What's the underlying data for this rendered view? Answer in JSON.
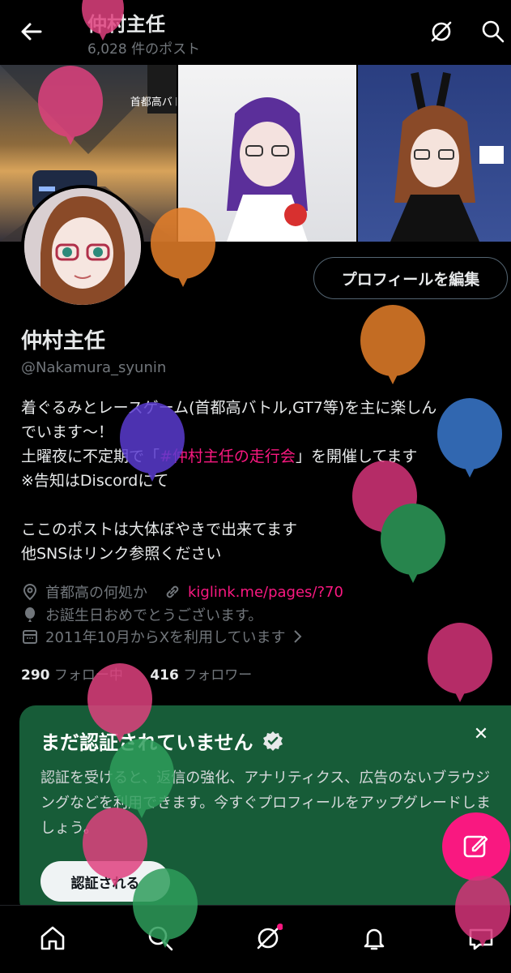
{
  "header": {
    "title": "仲村主任",
    "post_count": "6,028 件のポスト"
  },
  "banner_text": "首都高バトル",
  "profile": {
    "edit_button": "プロフィールを編集",
    "name": "仲村主任",
    "handle": "@Nakamura_syunin",
    "bio_line1": "着ぐるみとレースゲーム(首都高バトル,GT7等)を主に楽しん",
    "bio_line2": "でいます～！",
    "bio_line3_pre": "土曜夜に不定期で「",
    "bio_hashtag": "#仲村主任の走行会",
    "bio_line3_post": "」を開催してます",
    "bio_line4": "※告知はDiscordにて",
    "bio_line5": "ここのポストは大体ぼやきで出来てます",
    "bio_line6": "他SNSはリンク参照ください",
    "location": "首都高の何処か",
    "link": "kiglink.me/pages/?70",
    "birthday": "お誕生日おめでとうございます。",
    "joined": "2011年10月からXを利用しています",
    "following_count": "290",
    "following_label": "フォロー中",
    "followers_count": "416",
    "followers_label": "フォロワー"
  },
  "verify_card": {
    "title": "まだ認証されていません",
    "body": "認証を受けると、返信の強化、アナリティクス、広告のないブラウジングなどを利用できます。今すぐプロフィールをアップグレードしましょう。",
    "button": "認証される"
  },
  "bottom_nav": [
    "home-icon",
    "search-icon",
    "grok-icon",
    "notifications-icon",
    "messages-icon"
  ],
  "colors": {
    "accent": "#f91880",
    "card_bg": "#175c38",
    "muted": "#71767b"
  }
}
